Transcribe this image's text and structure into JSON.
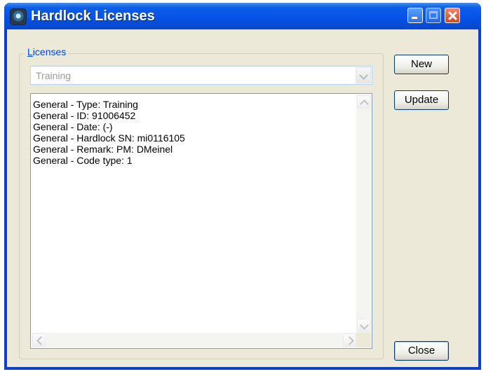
{
  "window": {
    "title": "Hardlock Licenses"
  },
  "titlebar_buttons": {
    "minimize": "minimize-icon",
    "maximize": "maximize-icon",
    "close": "close-icon"
  },
  "licenses": {
    "group_label_accel": "L",
    "group_label_rest": "icenses",
    "selected": "Training",
    "details": [
      "General - Type: Training",
      "General - ID: 91006452",
      "General - Date: (-)",
      "General - Hardlock SN: mi0116105",
      "General - Remark: PM: DMeinel",
      "General - Code type: 1"
    ]
  },
  "buttons": {
    "new": "New",
    "update": "Update",
    "close": "Close"
  },
  "colors": {
    "titlebar": "#0551e6",
    "client": "#ece9d8",
    "group_label": "#0046d5"
  }
}
